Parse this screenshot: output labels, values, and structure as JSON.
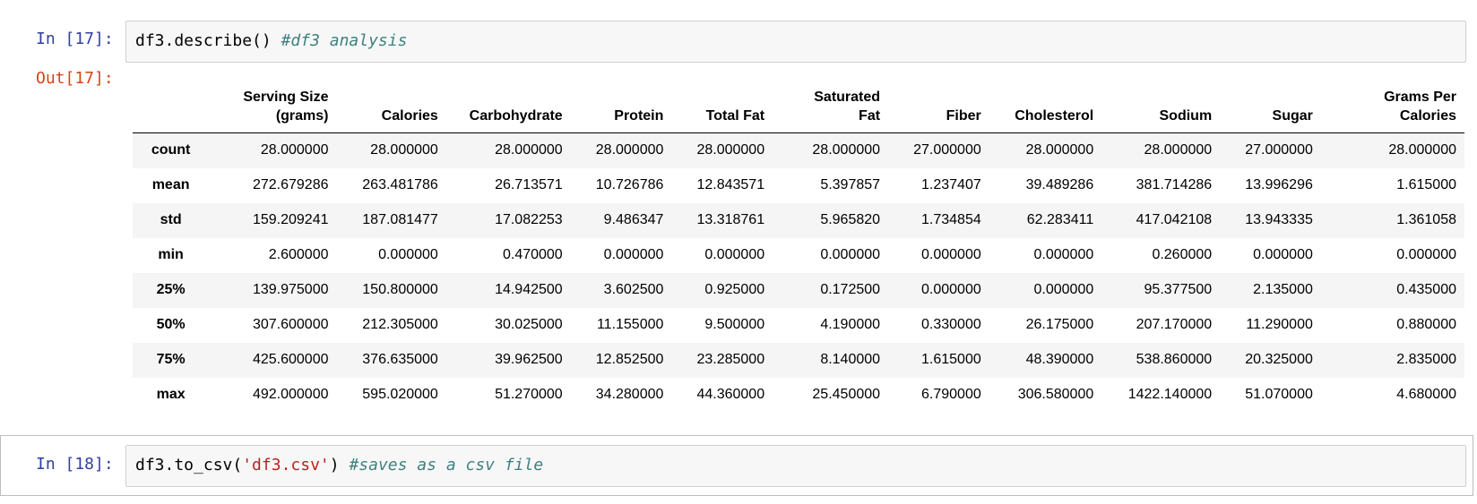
{
  "cells": [
    {
      "prompt": "In [17]:",
      "code": {
        "call": "df3.describe()",
        "comment": "#df3 analysis"
      }
    },
    {
      "out_prompt": "Out[17]:",
      "table": {
        "columns": [
          "Serving Size\n(grams)",
          "Calories",
          "Carbohydrate",
          "Protein",
          "Total Fat",
          "Saturated\nFat",
          "Fiber",
          "Cholesterol",
          "Sodium",
          "Sugar",
          "Grams Per\nCalories"
        ],
        "rows": [
          {
            "label": "count",
            "values": [
              "28.000000",
              "28.000000",
              "28.000000",
              "28.000000",
              "28.000000",
              "28.000000",
              "27.000000",
              "28.000000",
              "28.000000",
              "27.000000",
              "28.000000"
            ]
          },
          {
            "label": "mean",
            "values": [
              "272.679286",
              "263.481786",
              "26.713571",
              "10.726786",
              "12.843571",
              "5.397857",
              "1.237407",
              "39.489286",
              "381.714286",
              "13.996296",
              "1.615000"
            ]
          },
          {
            "label": "std",
            "values": [
              "159.209241",
              "187.081477",
              "17.082253",
              "9.486347",
              "13.318761",
              "5.965820",
              "1.734854",
              "62.283411",
              "417.042108",
              "13.943335",
              "1.361058"
            ]
          },
          {
            "label": "min",
            "values": [
              "2.600000",
              "0.000000",
              "0.470000",
              "0.000000",
              "0.000000",
              "0.000000",
              "0.000000",
              "0.000000",
              "0.260000",
              "0.000000",
              "0.000000"
            ]
          },
          {
            "label": "25%",
            "values": [
              "139.975000",
              "150.800000",
              "14.942500",
              "3.602500",
              "0.925000",
              "0.172500",
              "0.000000",
              "0.000000",
              "95.377500",
              "2.135000",
              "0.435000"
            ]
          },
          {
            "label": "50%",
            "values": [
              "307.600000",
              "212.305000",
              "30.025000",
              "11.155000",
              "9.500000",
              "4.190000",
              "0.330000",
              "26.175000",
              "207.170000",
              "11.290000",
              "0.880000"
            ]
          },
          {
            "label": "75%",
            "values": [
              "425.600000",
              "376.635000",
              "39.962500",
              "12.852500",
              "23.285000",
              "8.140000",
              "1.615000",
              "48.390000",
              "538.860000",
              "20.325000",
              "2.835000"
            ]
          },
          {
            "label": "max",
            "values": [
              "492.000000",
              "595.020000",
              "51.270000",
              "34.280000",
              "44.360000",
              "25.450000",
              "6.790000",
              "306.580000",
              "1422.140000",
              "51.070000",
              "4.680000"
            ]
          }
        ]
      }
    },
    {
      "prompt": "In [18]:",
      "code": {
        "call": "df3.to_csv(",
        "string": "'df3.csv'",
        "close": ")",
        "comment": "#saves as a csv file"
      }
    }
  ]
}
